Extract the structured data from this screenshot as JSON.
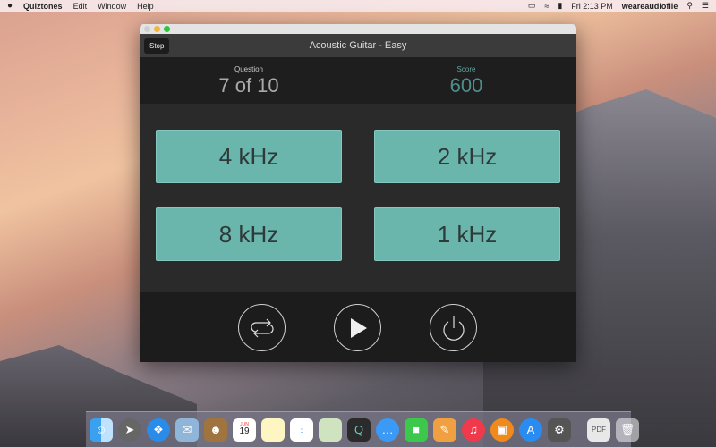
{
  "menubar": {
    "apple": "",
    "app": "Quiztones",
    "items": [
      "Edit",
      "Window",
      "Help"
    ],
    "clock": "Fri 2:13 PM",
    "user": "weareaudiofile",
    "icons": [
      "airplay-icon",
      "wifi-icon",
      "battery-icon",
      "search-icon",
      "list-icon"
    ]
  },
  "window": {
    "title": "Acoustic Guitar - Easy",
    "stop_label": "Stop",
    "question": {
      "label": "Question",
      "value": "7 of 10"
    },
    "score": {
      "label": "Score",
      "value": "600"
    },
    "answers": [
      "4 kHz",
      "2 kHz",
      "8 kHz",
      "1 kHz"
    ],
    "controls": [
      "repeat-icon",
      "play-icon",
      "power-icon"
    ],
    "colors": {
      "answer": "#6ab6ad",
      "score": "#4f8f8a"
    }
  },
  "dock": {
    "apps": [
      "Finder",
      "Launchpad",
      "Safari",
      "Mail",
      "Contacts",
      "Calendar",
      "Notes",
      "Reminders",
      "Maps",
      "Quiztones",
      "Messages",
      "FaceTime",
      "Pages",
      "iTunes",
      "iBooks",
      "App Store",
      "System Preferences"
    ],
    "calendar_month": "JUN",
    "calendar_day": "19"
  }
}
